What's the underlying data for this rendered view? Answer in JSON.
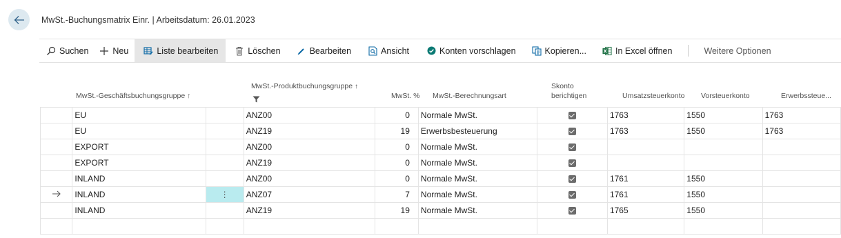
{
  "page": {
    "title": "MwSt.-Buchungsmatrix Einr. | Arbeitsdatum: 26.01.2023"
  },
  "actions": {
    "search": "Suchen",
    "new": "Neu",
    "edit_list": "Liste bearbeiten",
    "delete": "Löschen",
    "edit": "Bearbeiten",
    "view": "Ansicht",
    "suggest_accounts": "Konten vorschlagen",
    "copy": "Kopieren...",
    "open_excel": "In Excel öffnen",
    "more_options": "Weitere Optionen"
  },
  "columns": {
    "bus_group": "MwSt.-Geschäftsbuchungsgruppe",
    "prod_group": "MwSt.-Produktbuchungsgruppe",
    "vat_pct": "MwSt. %",
    "calc_type": "MwSt.-Berechnungsart",
    "skonto_line1": "Skonto",
    "skonto_line2": "berichtigen",
    "sales_account": "Umsatzsteuerkonto",
    "purchase_account": "Vorsteuerkonto",
    "acquisition_account": "Erwerbssteue..."
  },
  "rows": [
    {
      "bus": "EU",
      "prod": "ANZ00",
      "pct": "0",
      "calc": "Normale MwSt.",
      "skonto": true,
      "sales": "1763",
      "purch": "1550",
      "acq": "1763"
    },
    {
      "bus": "EU",
      "prod": "ANZ19",
      "pct": "19",
      "calc": "Erwerbsbesteuerung",
      "skonto": true,
      "sales": "1763",
      "purch": "1550",
      "acq": "1763"
    },
    {
      "bus": "EXPORT",
      "prod": "ANZ00",
      "pct": "0",
      "calc": "Normale MwSt.",
      "skonto": true,
      "sales": "",
      "purch": "",
      "acq": ""
    },
    {
      "bus": "EXPORT",
      "prod": "ANZ19",
      "pct": "0",
      "calc": "Normale MwSt.",
      "skonto": true,
      "sales": "",
      "purch": "",
      "acq": ""
    },
    {
      "bus": "INLAND",
      "prod": "ANZ00",
      "pct": "0",
      "calc": "Normale MwSt.",
      "skonto": true,
      "sales": "1761",
      "purch": "1550",
      "acq": ""
    },
    {
      "bus": "INLAND",
      "prod": "ANZ07",
      "pct": "7",
      "calc": "Normale MwSt.",
      "skonto": true,
      "sales": "1761",
      "purch": "1550",
      "acq": ""
    },
    {
      "bus": "INLAND",
      "prod": "ANZ19",
      "pct": "19",
      "calc": "Normale MwSt.",
      "skonto": true,
      "sales": "1765",
      "purch": "1550",
      "acq": ""
    }
  ],
  "icons": {
    "back": "arrow-left-icon",
    "search": "search-icon",
    "new": "plus-icon",
    "edit_list": "edit-list-icon",
    "delete": "trash-icon",
    "edit": "pencil-icon",
    "view": "view-icon",
    "suggest": "check-circle-icon",
    "copy": "copy-icon",
    "excel": "excel-icon",
    "filter": "filter-icon",
    "row_current": "arrow-right-icon",
    "row_menu": "vertical-dots-icon"
  },
  "colors": {
    "accent": "#0e6aa6",
    "selected_cell": "#b9ebef",
    "excel_green": "#1d7044",
    "suggest_teal": "#0b7a74"
  }
}
